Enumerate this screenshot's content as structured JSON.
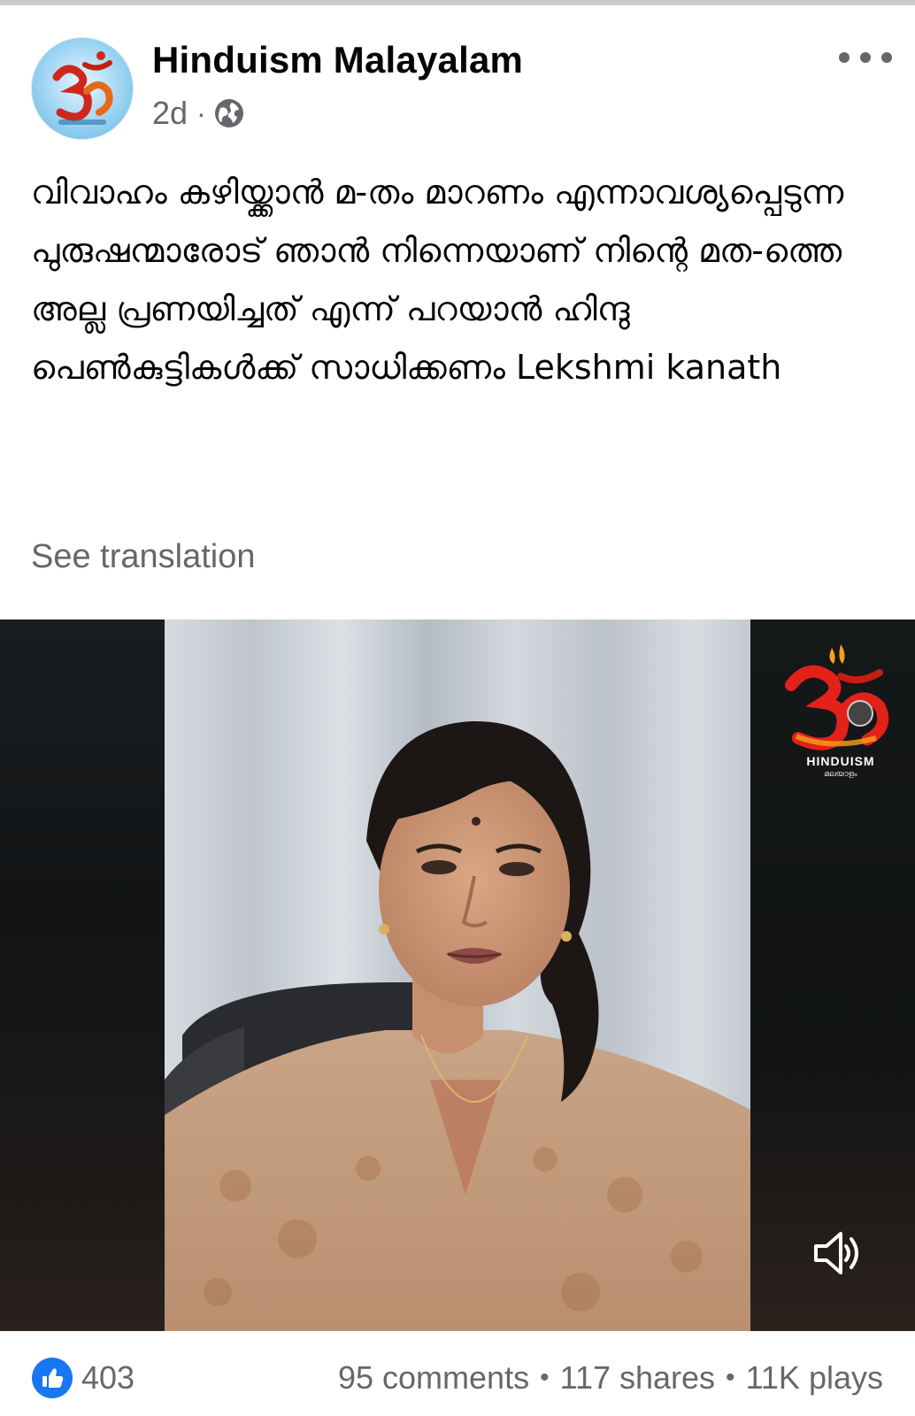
{
  "post": {
    "page_name": "Hinduism Malayalam",
    "time": "2d",
    "separator": "·",
    "privacy_icon": "globe-icon",
    "more_icon": "more-dots-icon",
    "text": "വിവാഹം കഴിയ്ക്കാൻ മ-തം മാറണം എന്നാവശ്യപ്പെടുന്ന പുരുഷന്മാരോട് ഞാൻ നിന്നെയാണ് നിന്റെ മത-ത്തെ അല്ല പ്രണയിച്ചത് എന്ന് പറയാൻ ഹിന്ദു പെൺകുട്ടികൾക്ക് സാധിക്കണം Lekshmi kanath",
    "see_translation": "See translation"
  },
  "video": {
    "watermark_title": "HINDUISM",
    "watermark_subtitle": "മലയാളം",
    "volume_icon": "volume-icon"
  },
  "stats": {
    "like_icon": "thumbs-up-icon",
    "like_color": "#1877f2",
    "likes": "403",
    "comments": "95 comments",
    "shares": "117 shares",
    "plays": "11K plays",
    "separator": "•"
  }
}
